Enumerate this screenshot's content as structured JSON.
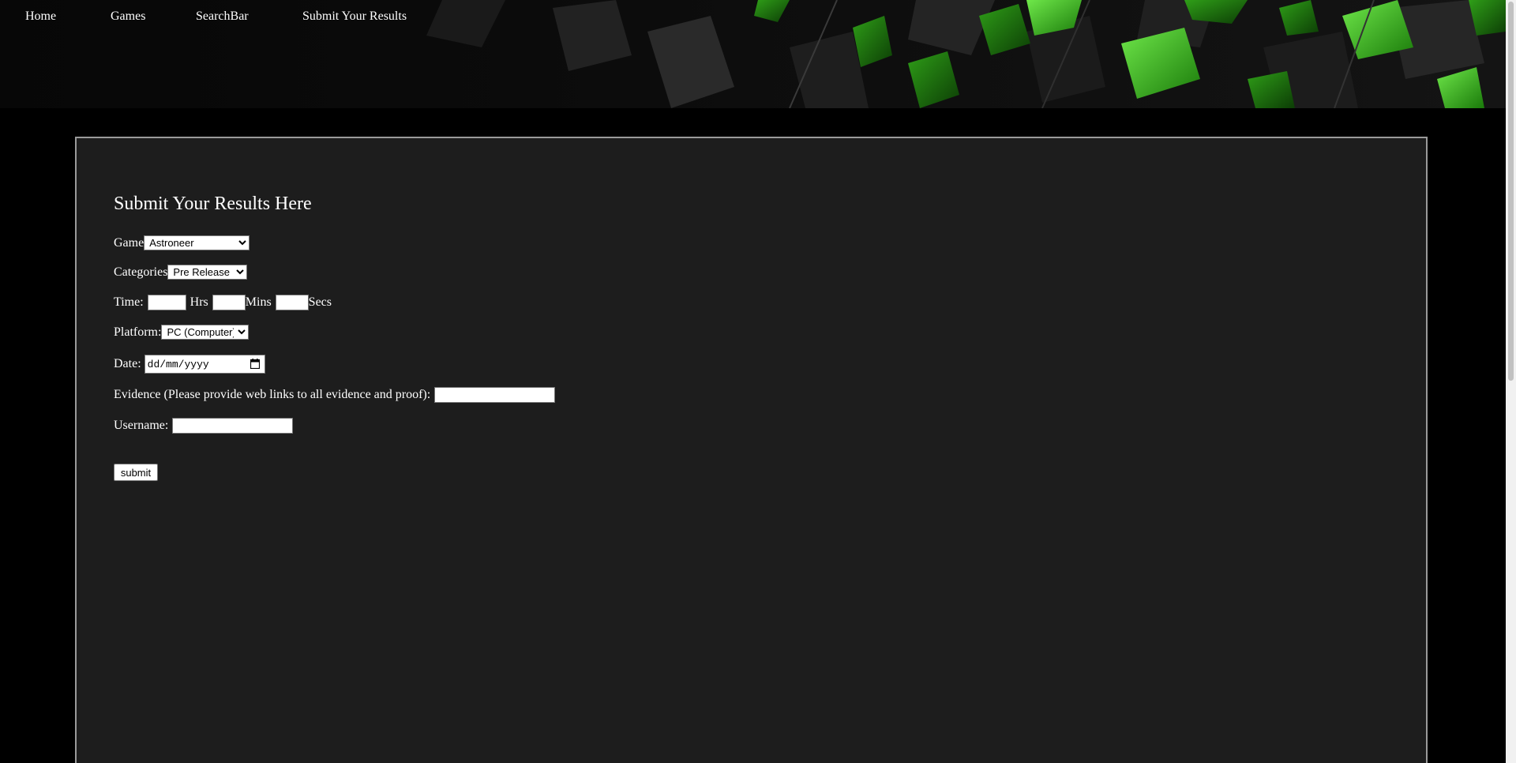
{
  "nav": {
    "items": [
      {
        "label": "Home"
      },
      {
        "label": "Games"
      },
      {
        "label": "SearchBar"
      },
      {
        "label": "Submit Your Results"
      }
    ]
  },
  "form": {
    "title": "Submit Your Results Here",
    "game": {
      "label": "Game",
      "selected": "Astroneer"
    },
    "categories": {
      "label": "Categories",
      "selected": "Pre Release"
    },
    "time": {
      "label": "Time:",
      "hrs_label": "Hrs",
      "mins_label": "Mins",
      "secs_label": "Secs",
      "hrs_value": "",
      "mins_value": "",
      "secs_value": ""
    },
    "platform": {
      "label": "Platform:",
      "selected": "PC (Computer)"
    },
    "date": {
      "label": "Date:",
      "placeholder": "dd/mm/yyyy"
    },
    "evidence": {
      "label": "Evidence (Please provide web links to all evidence and proof):",
      "value": ""
    },
    "username": {
      "label": "Username:",
      "value": ""
    },
    "submit_label": "submit"
  },
  "colors": {
    "page_background": "#000000",
    "panel_background": "#1d1d1d",
    "panel_border": "#9a9a9a",
    "accent_green": "#3fbf1f"
  },
  "icons": {
    "date_picker": "calendar-icon"
  }
}
